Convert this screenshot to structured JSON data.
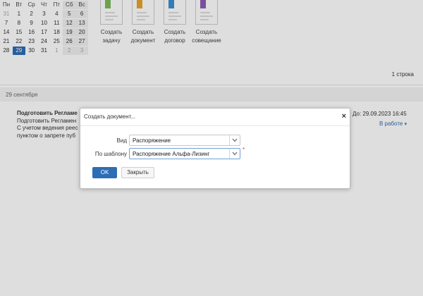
{
  "calendar": {
    "weekdays": [
      "Пн",
      "Вт",
      "Ср",
      "Чт",
      "Пт",
      "Сб",
      "Вс"
    ],
    "weeks": [
      [
        "31",
        "1",
        "2",
        "3",
        "4",
        "5",
        "6"
      ],
      [
        "7",
        "8",
        "9",
        "10",
        "11",
        "12",
        "13"
      ],
      [
        "14",
        "15",
        "16",
        "17",
        "18",
        "19",
        "20"
      ],
      [
        "21",
        "22",
        "23",
        "24",
        "25",
        "26",
        "27"
      ],
      [
        "28",
        "29",
        "30",
        "31",
        "1",
        "2",
        "3"
      ]
    ],
    "selected": "29"
  },
  "tiles": [
    {
      "line1": "Создать",
      "line2": "задачу",
      "color": "#7dba5a"
    },
    {
      "line1": "Создать",
      "line2": "документ",
      "color": "#e6a52d"
    },
    {
      "line1": "Создать",
      "line2": "договор",
      "color": "#3b8fd1"
    },
    {
      "line1": "Создать",
      "line2": "совещание",
      "color": "#8c5bb5"
    }
  ],
  "list": {
    "count": "1 строка",
    "date_header": "29 сентября",
    "task": {
      "title": "Подготовить Регламе",
      "line1": "Подготовить Регламен",
      "line2": "С учетом ведения реес",
      "line3": "пунктом о запрете пуб",
      "due": "До: 29.09.2023 16:45",
      "status": "В работе"
    }
  },
  "dialog": {
    "title": "Создать документ...",
    "close": "×",
    "kind_label": "Вид",
    "kind_value": "Распоряжение",
    "template_label": "По шаблону",
    "template_value": "Распоряжение Альфа-Лизинг",
    "required_mark": "*",
    "ok_label": "OK",
    "close_label": "Закрыть"
  }
}
